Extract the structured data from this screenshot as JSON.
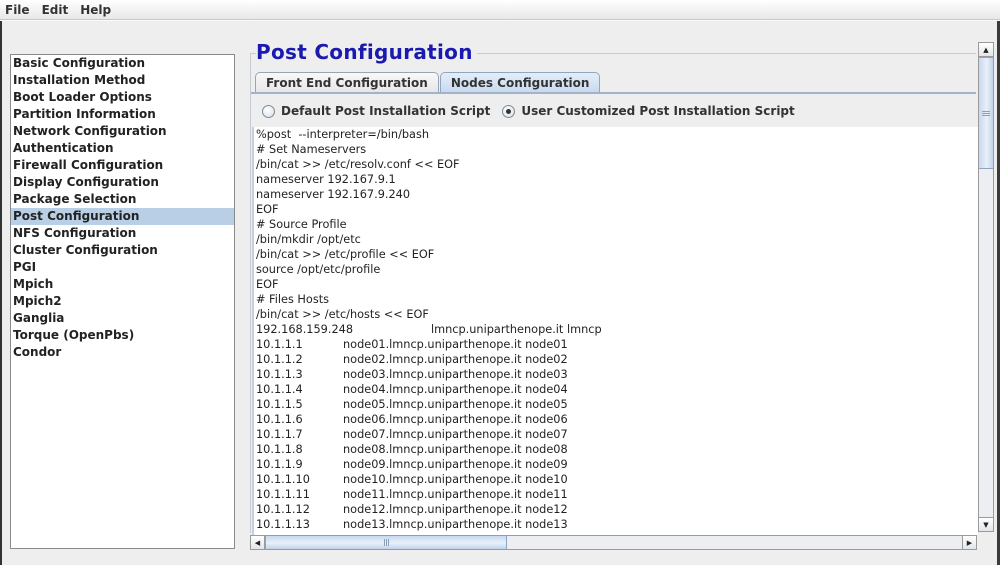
{
  "menubar": {
    "items": [
      "File",
      "Edit",
      "Help"
    ]
  },
  "sidebar": {
    "selected_index": 9,
    "items": [
      "Basic Configuration",
      "Installation Method",
      "Boot Loader Options",
      "Partition Information",
      "Network Configuration",
      "Authentication",
      "Firewall Configuration",
      "Display Configuration",
      "Package Selection",
      "Post Configuration",
      "NFS Configuration",
      "Cluster Configuration",
      "PGI",
      "Mpich",
      "Mpich2",
      "Ganglia",
      "Torque (OpenPbs)",
      "Condor"
    ]
  },
  "main": {
    "title": "Post Configuration",
    "tabs": [
      {
        "label": "Front End Configuration",
        "active": false
      },
      {
        "label": "Nodes Configuration",
        "active": true
      }
    ],
    "radios": [
      {
        "label": "Default Post Installation Script",
        "checked": false
      },
      {
        "label": "User Customized Post Installation Script",
        "checked": true
      }
    ],
    "script_lines": [
      "%post  --interpreter=/bin/bash",
      "# Set Nameservers",
      "/bin/cat >> /etc/resolv.conf << EOF",
      "nameserver 192.167.9.1",
      "nameserver 192.167.9.240",
      "EOF",
      "# Source Profile",
      "/bin/mkdir /opt/etc",
      "/bin/cat >> /etc/profile << EOF",
      "source /opt/etc/profile",
      "EOF",
      "# Files Hosts",
      "/bin/cat >> /etc/hosts << EOF"
    ],
    "front_host": {
      "ip": "192.168.159.248",
      "names": "lmncp.uniparthenope.it lmncp"
    },
    "hosts": [
      {
        "ip": "10.1.1.1",
        "names": "node01.lmncp.uniparthenope.it node01"
      },
      {
        "ip": "10.1.1.2",
        "names": "node02.lmncp.uniparthenope.it node02"
      },
      {
        "ip": "10.1.1.3",
        "names": "node03.lmncp.uniparthenope.it node03"
      },
      {
        "ip": "10.1.1.4",
        "names": "node04.lmncp.uniparthenope.it node04"
      },
      {
        "ip": "10.1.1.5",
        "names": "node05.lmncp.uniparthenope.it node05"
      },
      {
        "ip": "10.1.1.6",
        "names": "node06.lmncp.uniparthenope.it node06"
      },
      {
        "ip": "10.1.1.7",
        "names": "node07.lmncp.uniparthenope.it node07"
      },
      {
        "ip": "10.1.1.8",
        "names": "node08.lmncp.uniparthenope.it node08"
      },
      {
        "ip": "10.1.1.9",
        "names": "node09.lmncp.uniparthenope.it node09"
      },
      {
        "ip": "10.1.1.10",
        "names": "node10.lmncp.uniparthenope.it node10"
      },
      {
        "ip": "10.1.1.11",
        "names": "node11.lmncp.uniparthenope.it node11"
      },
      {
        "ip": "10.1.1.12",
        "names": "node12.lmncp.uniparthenope.it node12"
      },
      {
        "ip": "10.1.1.13",
        "names": "node13.lmncp.uniparthenope.it node13"
      }
    ]
  },
  "icons": {
    "scroll_up": "▲",
    "scroll_down": "▼",
    "scroll_left": "◀",
    "scroll_right": "▶"
  },
  "colors": {
    "title": "#1a1ab0",
    "selection": "#b8cfe5",
    "active_tab": "#c7d9ee"
  }
}
